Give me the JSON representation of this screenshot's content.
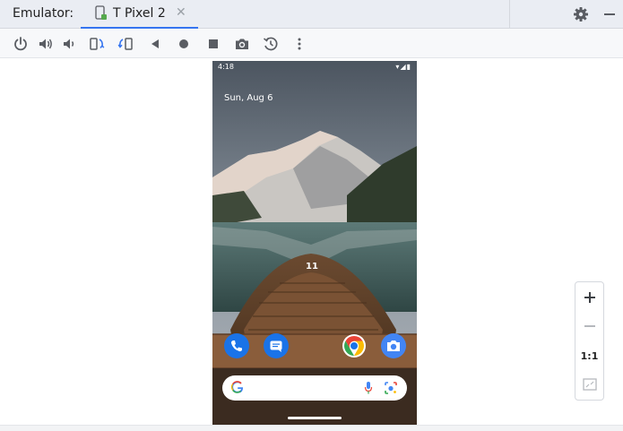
{
  "header": {
    "title": "Emulator:",
    "tab_label": "T Pixel 2",
    "close_glyph": "✕",
    "settings_icon": "gear-icon",
    "minimize_icon": "minimize-icon"
  },
  "toolbar": {
    "items": [
      "power-icon",
      "volume-up-icon",
      "volume-down-icon",
      "rotate-left-icon",
      "rotate-right-icon",
      "back-icon",
      "home-icon",
      "overview-icon",
      "screenshot-icon",
      "snapshot-icon",
      "more-icon"
    ]
  },
  "phone": {
    "status_time": "4:18",
    "status_icons": "▾◢▮",
    "date": "Sun, Aug 6",
    "clock": "11",
    "dock": [
      "phone-icon",
      "messages-icon",
      "chrome-icon",
      "camera-icon"
    ]
  },
  "zoom": {
    "zoom_in": "+",
    "zoom_out": "−",
    "actual_size": "1:1",
    "fit_icon": "fit-screen-icon"
  },
  "colors": {
    "accent": "#3574f0",
    "header_bg": "#eaedf3",
    "toolbar_bg": "#f7f8fa",
    "icon_gray": "#5a5d63",
    "icon_blue": "#3574f0"
  }
}
